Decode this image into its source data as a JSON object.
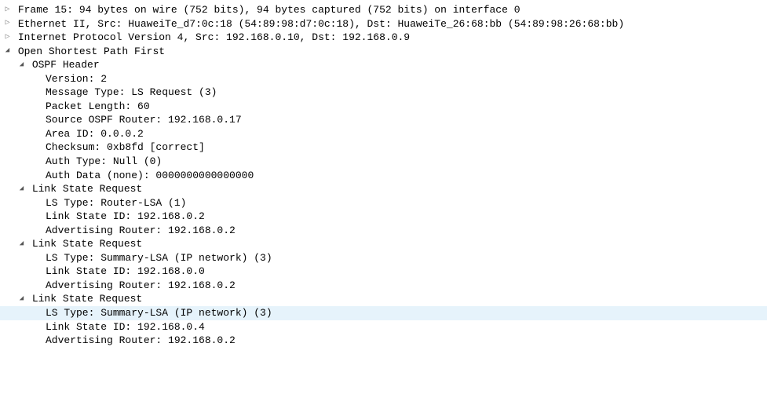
{
  "frame": {
    "summary": "Frame 15: 94 bytes on wire (752 bits), 94 bytes captured (752 bits) on interface 0"
  },
  "ethernet": {
    "summary": "Ethernet II, Src: HuaweiTe_d7:0c:18 (54:89:98:d7:0c:18), Dst: HuaweiTe_26:68:bb (54:89:98:26:68:bb)"
  },
  "ip": {
    "summary": "Internet Protocol Version 4, Src: 192.168.0.10, Dst: 192.168.0.9"
  },
  "ospf": {
    "summary": "Open Shortest Path First",
    "header": {
      "label": "OSPF Header",
      "version": "Version: 2",
      "msgtype": "Message Type: LS Request (3)",
      "length": "Packet Length: 60",
      "source_router": "Source OSPF Router: 192.168.0.17",
      "area_id": "Area ID: 0.0.0.2",
      "checksum": "Checksum: 0xb8fd [correct]",
      "auth_type": "Auth Type: Null (0)",
      "auth_data": "Auth Data (none): 0000000000000000"
    },
    "lsr1": {
      "label": "Link State Request",
      "ls_type": "LS Type: Router-LSA (1)",
      "ls_id": "Link State ID: 192.168.0.2",
      "adv_router": "Advertising Router: 192.168.0.2"
    },
    "lsr2": {
      "label": "Link State Request",
      "ls_type": "LS Type: Summary-LSA (IP network) (3)",
      "ls_id": "Link State ID: 192.168.0.0",
      "adv_router": "Advertising Router: 192.168.0.2"
    },
    "lsr3": {
      "label": "Link State Request",
      "ls_type": "LS Type: Summary-LSA (IP network) (3)",
      "ls_id": "Link State ID: 192.168.0.4",
      "adv_router": "Advertising Router: 192.168.0.2"
    }
  }
}
